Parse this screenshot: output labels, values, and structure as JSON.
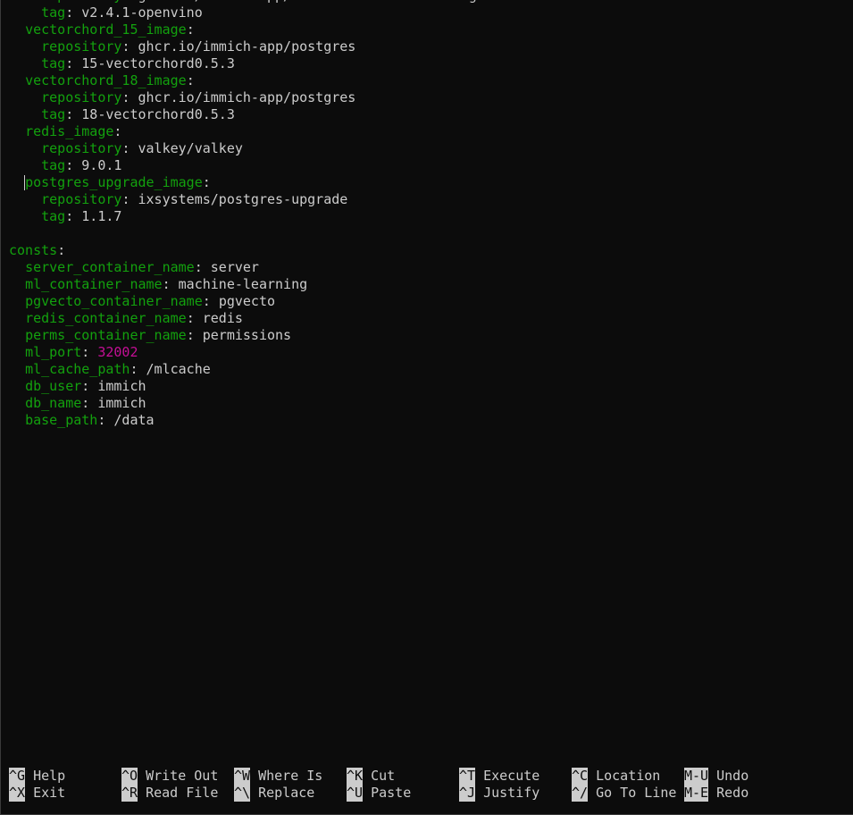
{
  "editor": {
    "lines": [
      {
        "indent": "    ",
        "key": "repository",
        "sep": ": ",
        "value": "ghcr.io/immich-app/immich-machine-learning",
        "type": "str"
      },
      {
        "indent": "    ",
        "key": "tag",
        "sep": ": ",
        "value": "v2.4.1-openvino",
        "type": "str"
      },
      {
        "indent": "  ",
        "key": "vectorchord_15_image",
        "sep": ":",
        "value": "",
        "type": "str"
      },
      {
        "indent": "    ",
        "key": "repository",
        "sep": ": ",
        "value": "ghcr.io/immich-app/postgres",
        "type": "str"
      },
      {
        "indent": "    ",
        "key": "tag",
        "sep": ": ",
        "value": "15-vectorchord0.5.3",
        "type": "str"
      },
      {
        "indent": "  ",
        "key": "vectorchord_18_image",
        "sep": ":",
        "value": "",
        "type": "str"
      },
      {
        "indent": "    ",
        "key": "repository",
        "sep": ": ",
        "value": "ghcr.io/immich-app/postgres",
        "type": "str"
      },
      {
        "indent": "    ",
        "key": "tag",
        "sep": ": ",
        "value": "18-vectorchord0.5.3",
        "type": "str"
      },
      {
        "indent": "  ",
        "key": "redis_image",
        "sep": ":",
        "value": "",
        "type": "str"
      },
      {
        "indent": "    ",
        "key": "repository",
        "sep": ": ",
        "value": "valkey/valkey",
        "type": "str"
      },
      {
        "indent": "    ",
        "key": "tag",
        "sep": ": ",
        "value": "9.0.1",
        "type": "str"
      },
      {
        "indent": "  ",
        "key": "postgres_upgrade_image",
        "sep": ":",
        "value": "",
        "type": "str",
        "cursor": true
      },
      {
        "indent": "    ",
        "key": "repository",
        "sep": ": ",
        "value": "ixsystems/postgres-upgrade",
        "type": "str"
      },
      {
        "indent": "    ",
        "key": "tag",
        "sep": ": ",
        "value": "1.1.7",
        "type": "str"
      },
      {
        "indent": "",
        "key": "",
        "sep": "",
        "value": "",
        "type": "str"
      },
      {
        "indent": "",
        "key": "consts",
        "sep": ":",
        "value": "",
        "type": "str"
      },
      {
        "indent": "  ",
        "key": "server_container_name",
        "sep": ": ",
        "value": "server",
        "type": "str"
      },
      {
        "indent": "  ",
        "key": "ml_container_name",
        "sep": ": ",
        "value": "machine-learning",
        "type": "str"
      },
      {
        "indent": "  ",
        "key": "pgvecto_container_name",
        "sep": ": ",
        "value": "pgvecto",
        "type": "str"
      },
      {
        "indent": "  ",
        "key": "redis_container_name",
        "sep": ": ",
        "value": "redis",
        "type": "str"
      },
      {
        "indent": "  ",
        "key": "perms_container_name",
        "sep": ": ",
        "value": "permissions",
        "type": "str"
      },
      {
        "indent": "  ",
        "key": "ml_port",
        "sep": ": ",
        "value": "32002",
        "type": "num"
      },
      {
        "indent": "  ",
        "key": "ml_cache_path",
        "sep": ": ",
        "value": "/mlcache",
        "type": "str"
      },
      {
        "indent": "  ",
        "key": "db_user",
        "sep": ": ",
        "value": "immich",
        "type": "str"
      },
      {
        "indent": "  ",
        "key": "db_name",
        "sep": ": ",
        "value": "immich",
        "type": "str"
      },
      {
        "indent": "  ",
        "key": "base_path",
        "sep": ": ",
        "value": "/data",
        "type": "str"
      }
    ]
  },
  "shortcuts": {
    "row1": [
      {
        "key": "^G",
        "label": " Help"
      },
      {
        "key": "^O",
        "label": " Write Out"
      },
      {
        "key": "^W",
        "label": " Where Is"
      },
      {
        "key": "^K",
        "label": " Cut"
      },
      {
        "key": "^T",
        "label": " Execute"
      },
      {
        "key": "^C",
        "label": " Location"
      },
      {
        "key": "M-U",
        "label": " Undo"
      }
    ],
    "row2": [
      {
        "key": "^X",
        "label": " Exit"
      },
      {
        "key": "^R",
        "label": " Read File"
      },
      {
        "key": "^\\",
        "label": " Replace"
      },
      {
        "key": "^U",
        "label": " Paste"
      },
      {
        "key": "^J",
        "label": " Justify"
      },
      {
        "key": "^/",
        "label": " Go To Line"
      },
      {
        "key": "M-E",
        "label": " Redo"
      }
    ]
  },
  "colors": {
    "background": "#0c0c0c",
    "key": "#13a10e",
    "text": "#cccccc",
    "number": "#c50f96"
  }
}
